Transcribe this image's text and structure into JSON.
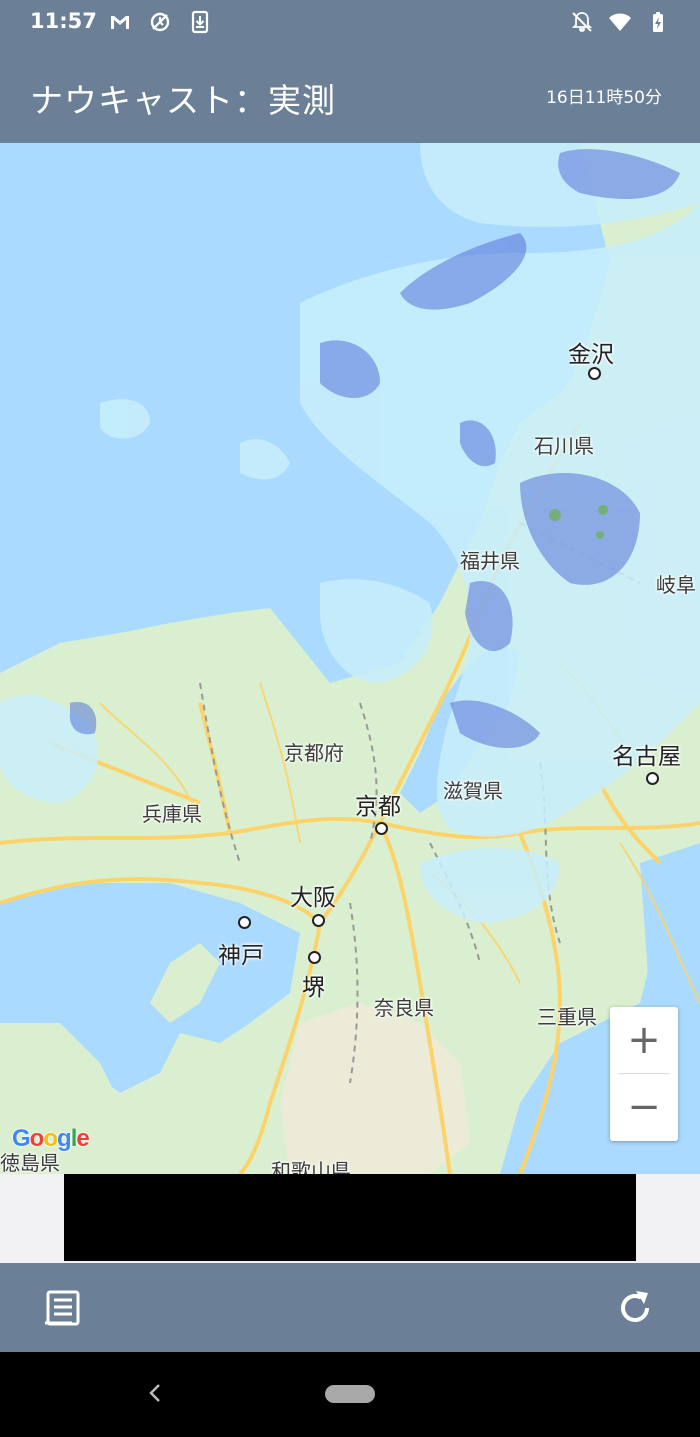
{
  "status_bar": {
    "time": "11:57",
    "left_icons": [
      "gmail-icon",
      "sync-off-icon",
      "download-icon"
    ],
    "right_icons": [
      "notifications-off-icon",
      "wifi-icon",
      "battery-charging-icon"
    ]
  },
  "app_bar": {
    "title": "ナウキャスト：実測",
    "timestamp": "16日11時50分"
  },
  "map": {
    "labels": {
      "kanazawa": "金沢",
      "ishikawa": "石川県",
      "fukui": "福井県",
      "gifu": "岐阜",
      "kyoto_pref": "京都府",
      "nagoya": "名古屋",
      "shiga": "滋賀県",
      "kyoto": "京都",
      "hyogo": "兵庫県",
      "osaka": "大阪",
      "kobe": "神戸",
      "sakai": "堺",
      "nara": "奈良県",
      "mie": "三重県",
      "tokushima": "徳島県",
      "wakayama": "和歌山県"
    },
    "zoom_in_label": "+",
    "zoom_out_label": "−",
    "attribution": "Google"
  },
  "bottom_bar": {
    "left_icon": "list-icon",
    "right_icon": "refresh-icon"
  },
  "colors": {
    "app_bar": "#6b7f96",
    "sea": "#aadaff",
    "land": "#d9efcf",
    "road": "#fcd36b",
    "rain_light": "#c8eefc",
    "rain_moderate": "#5a74d8"
  }
}
